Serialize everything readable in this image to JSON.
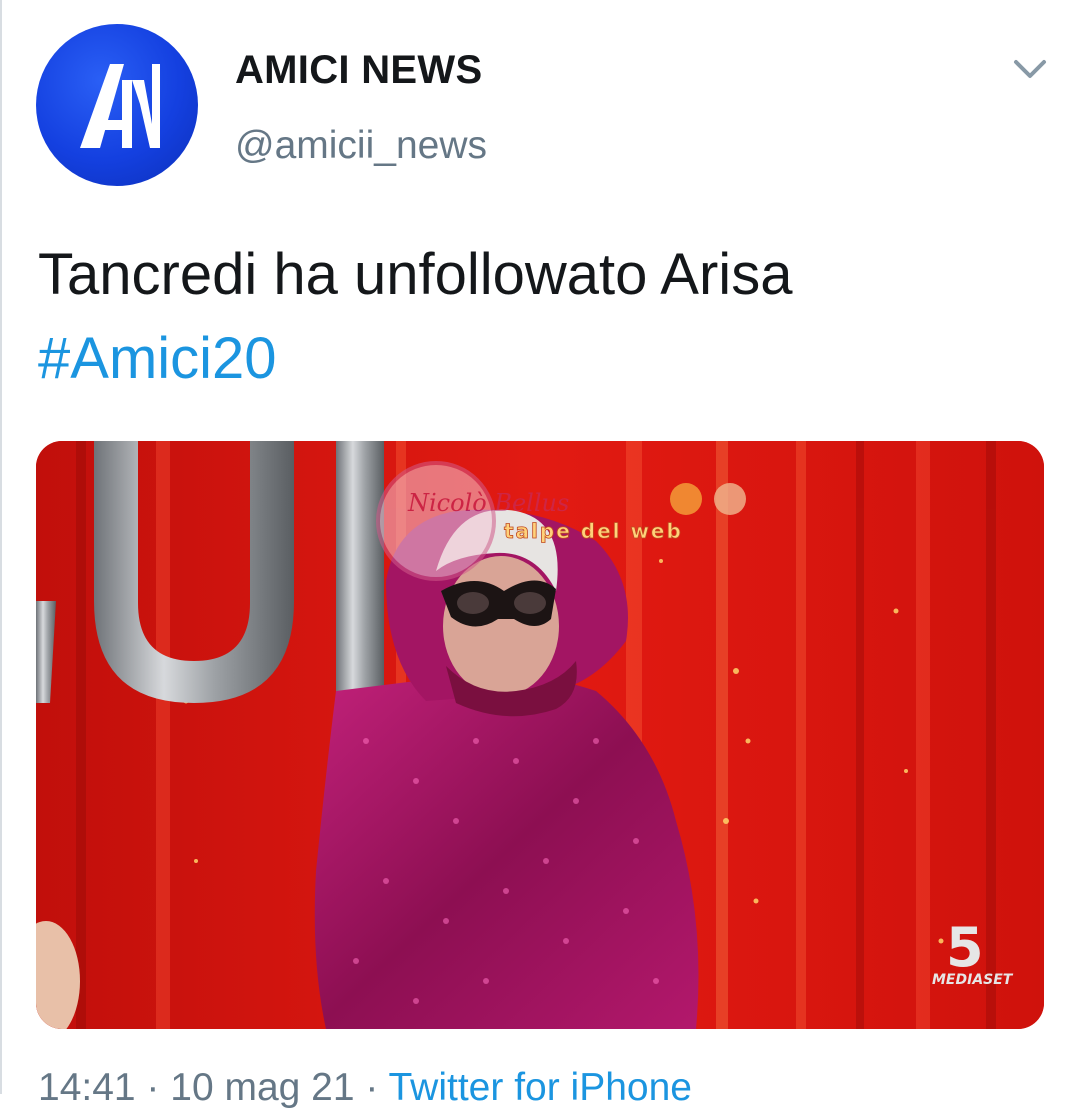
{
  "tweet": {
    "author": {
      "display_name": "AMICI NEWS",
      "handle": "@amicii_news",
      "avatar_letters": "AN"
    },
    "text": "Tancredi ha unfollowato Arisa",
    "hashtag": "#Amici20",
    "media": {
      "watermarks": [
        "Nicolò Bellus",
        "talpe del web"
      ],
      "broadcaster_logo": "5",
      "broadcaster_name": "MEDIASET"
    },
    "timestamp": "14:41 · 10 mag 21 · ",
    "source": "Twitter for iPhone"
  },
  "colors": {
    "link": "#1b95e0",
    "secondary_text": "#657786",
    "avatar_blue": "#1440e0",
    "stage_red": "#d4130d",
    "sequin_magenta": "#b0146a"
  },
  "icons": {
    "menu": "chevron-down-icon"
  }
}
